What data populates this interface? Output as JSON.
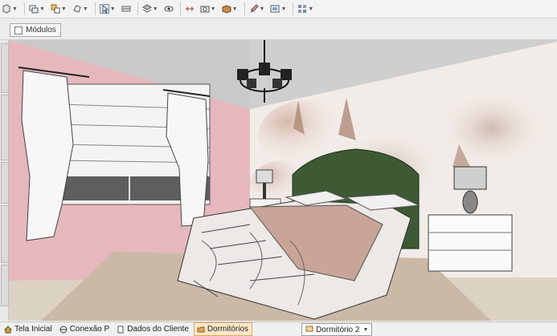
{
  "toolbar": {
    "buttons": [
      {
        "icon": "cube-select-icon"
      },
      {
        "icon": "module-icon"
      },
      {
        "icon": "copy-icon"
      },
      {
        "icon": "rotate-icon"
      },
      {
        "icon": "pointer-icon"
      },
      {
        "icon": "wall-icon"
      },
      {
        "icon": "layer-icon"
      },
      {
        "icon": "eye-icon"
      },
      {
        "icon": "arrows-icon"
      },
      {
        "icon": "camera-icon"
      },
      {
        "icon": "box-icon"
      },
      {
        "icon": "brush-icon"
      },
      {
        "icon": "render-icon"
      },
      {
        "icon": "grid-icon"
      }
    ]
  },
  "module_tab": {
    "label": "Módulos"
  },
  "status": {
    "tabs": [
      {
        "label": "Tela Inicial",
        "icon": "home-icon",
        "active": false
      },
      {
        "label": "Conexão P",
        "icon": "globe-icon",
        "active": false
      },
      {
        "label": "Dados do Cliente",
        "icon": "document-icon",
        "active": false
      },
      {
        "label": "Dormitórios",
        "icon": "folder-icon",
        "active": true
      }
    ],
    "environment": {
      "label": "Dormitório 2"
    }
  },
  "colors": {
    "wall_pink": "#e6b8be",
    "ceiling": "#cfcfcf",
    "bed_head": "#3d5a34",
    "rug": "#cbb9a6",
    "floor": "#dcd2c4",
    "active_tab": "#fde7c8"
  }
}
